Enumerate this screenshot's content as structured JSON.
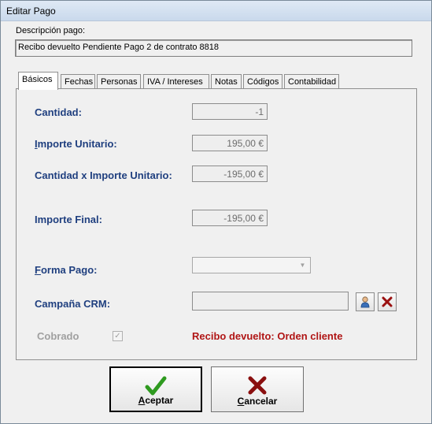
{
  "window": {
    "title": "Editar Pago"
  },
  "description": {
    "label": "Descripción pago:",
    "value": "Recibo devuelto Pendiente Pago 2 de contrato 8818"
  },
  "tabs": [
    {
      "label": "Básicos",
      "active": true
    },
    {
      "label": "Fechas"
    },
    {
      "label": "Personas"
    },
    {
      "label": "IVA / Intereses"
    },
    {
      "label": "Notas"
    },
    {
      "label": "Códigos"
    },
    {
      "label": "Contabilidad"
    }
  ],
  "fields": {
    "cantidad": {
      "label": "Cantidad:",
      "value": "-1"
    },
    "importe_unitario": {
      "label_accel": "I",
      "label_rest": "mporte Unitario:",
      "value": "195,00 €"
    },
    "cantidad_x_importe": {
      "label": "Cantidad x Importe Unitario:",
      "value": "-195,00 €"
    },
    "importe_final": {
      "label": "Importe Final:",
      "value": "-195,00 €"
    },
    "forma_pago": {
      "label_accel": "F",
      "label_rest": "orma Pago:",
      "value": ""
    },
    "campana_crm": {
      "label": "Campaña CRM:",
      "value": ""
    },
    "cobrado": {
      "label": "Cobrado",
      "checked": true
    }
  },
  "icons": {
    "crm_select": "person-icon",
    "crm_clear": "x-icon",
    "accept": "checkmark-icon",
    "cancel": "x-icon"
  },
  "status_text": "Recibo devuelto: Orden cliente",
  "buttons": {
    "accept": {
      "accel": "A",
      "rest": "ceptar"
    },
    "cancel": {
      "accel": "C",
      "rest": "ancelar"
    }
  },
  "colors": {
    "label_blue": "#1f3f7f",
    "status_red": "#b01515",
    "accept_green": "#2e9a1f",
    "cancel_red": "#8a0f0f"
  }
}
